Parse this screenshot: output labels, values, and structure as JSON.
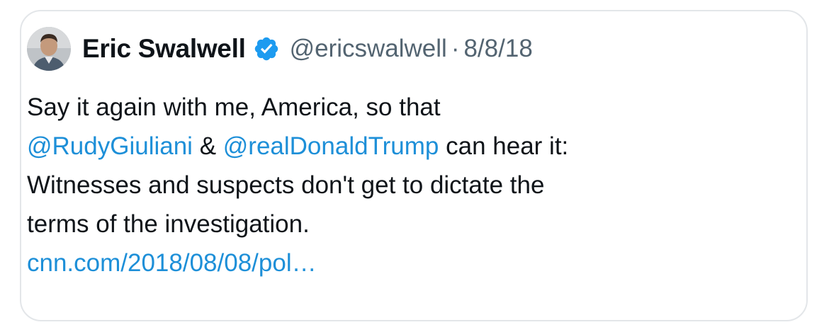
{
  "tweet": {
    "author_name": "Eric Swalwell",
    "handle": "@ericswalwell",
    "separator": "·",
    "date": "8/8/18",
    "verified": true,
    "avatar_icon": "profile-photo",
    "lines": {
      "line1": "Say it again with me, America, so that",
      "mention1": "@RudyGiuliani",
      "amp": " & ",
      "mention2": "@realDonaldTrump",
      "line2_tail": " can hear it:",
      "line3": "Witnesses and suspects don't get to dictate the",
      "line4": "terms of the investigation.",
      "link": "cnn.com/2018/08/08/pol…"
    }
  },
  "colors": {
    "text": "#0f1419",
    "secondary": "#536471",
    "link": "#1d8fd8",
    "verified_badge": "#1d9bf0",
    "border": "#e3e6e9"
  }
}
